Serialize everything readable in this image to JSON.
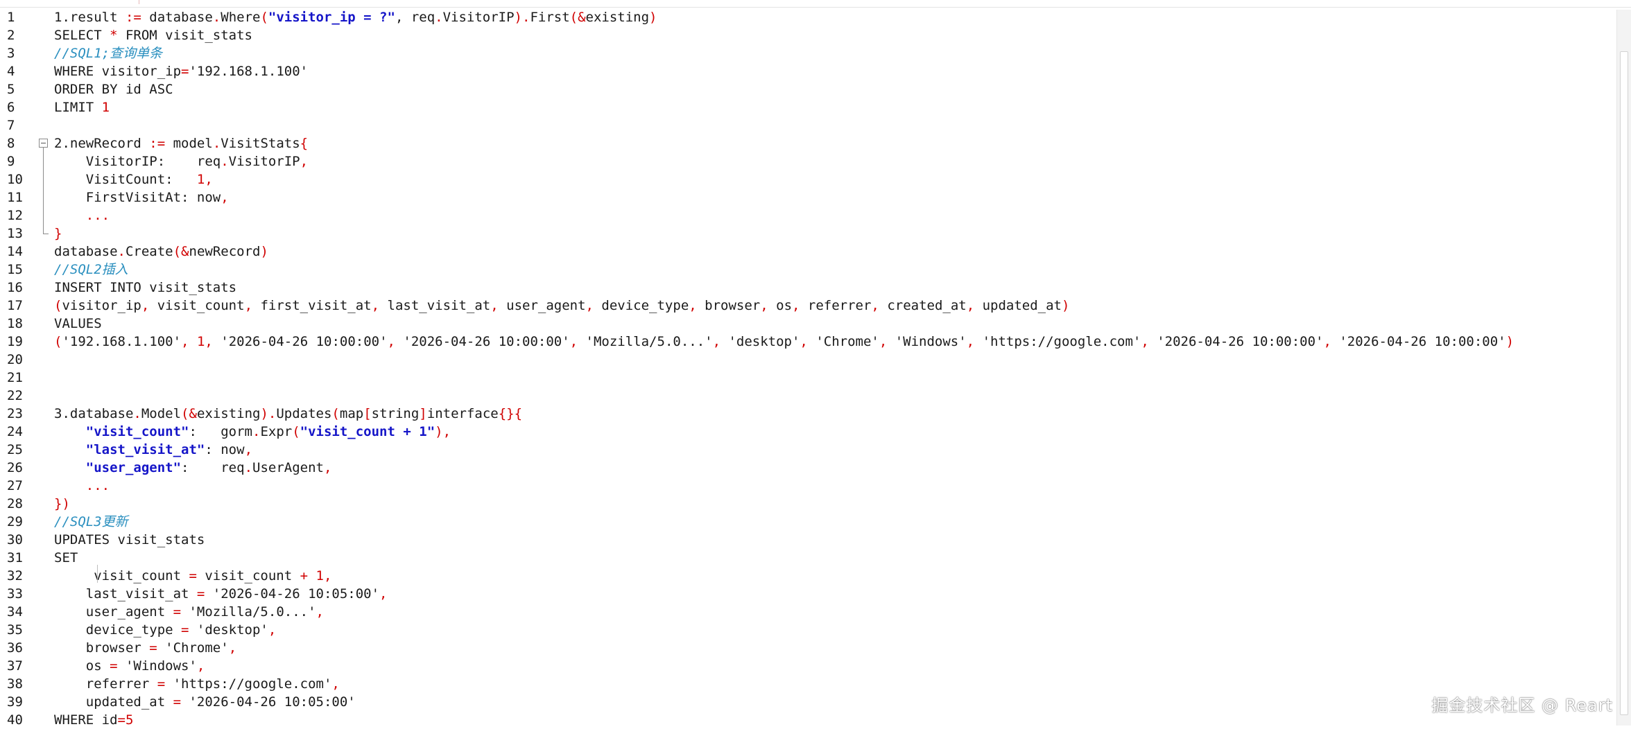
{
  "editor": {
    "line_numbers": [
      "1",
      "2",
      "3",
      "4",
      "5",
      "6",
      "7",
      "8",
      "9",
      "10",
      "11",
      "12",
      "13",
      "14",
      "15",
      "16",
      "17",
      "18",
      "19",
      "20",
      "21",
      "22",
      "23",
      "24",
      "25",
      "26",
      "27",
      "28",
      "29",
      "30",
      "31",
      "32",
      "33",
      "34",
      "35",
      "36",
      "37",
      "38",
      "39",
      "40"
    ],
    "lines": [
      [
        {
          "t": "1.result ",
          "c": "txt"
        },
        {
          "t": ":=",
          "c": "op"
        },
        {
          "t": " database",
          "c": "txt"
        },
        {
          "t": ".",
          "c": "op"
        },
        {
          "t": "Where",
          "c": "txt"
        },
        {
          "t": "(",
          "c": "op"
        },
        {
          "t": "\"visitor_ip = ?\"",
          "c": "str"
        },
        {
          "t": ", req",
          "c": "txt"
        },
        {
          "t": ".",
          "c": "op"
        },
        {
          "t": "VisitorIP",
          "c": "txt"
        },
        {
          "t": ").",
          "c": "op"
        },
        {
          "t": "First",
          "c": "txt"
        },
        {
          "t": "(&",
          "c": "op"
        },
        {
          "t": "existing",
          "c": "txt"
        },
        {
          "t": ")",
          "c": "op"
        }
      ],
      [
        {
          "t": "SELECT ",
          "c": "txt"
        },
        {
          "t": "*",
          "c": "op"
        },
        {
          "t": " FROM visit_stats",
          "c": "txt"
        }
      ],
      [
        {
          "t": "//SQL1;查询单条",
          "c": "cm"
        }
      ],
      [
        {
          "t": "WHERE visitor_ip",
          "c": "txt"
        },
        {
          "t": "=",
          "c": "op"
        },
        {
          "t": "'192.168.1.100'",
          "c": "txt"
        }
      ],
      [
        {
          "t": "ORDER BY id ASC",
          "c": "txt"
        }
      ],
      [
        {
          "t": "LIMIT ",
          "c": "txt"
        },
        {
          "t": "1",
          "c": "num"
        }
      ],
      [],
      [
        {
          "t": "2.newRecord ",
          "c": "txt"
        },
        {
          "t": ":=",
          "c": "op"
        },
        {
          "t": " model",
          "c": "txt"
        },
        {
          "t": ".",
          "c": "op"
        },
        {
          "t": "VisitStats",
          "c": "txt"
        },
        {
          "t": "{",
          "c": "op"
        }
      ],
      [
        {
          "t": "    VisitorIP:    req",
          "c": "txt"
        },
        {
          "t": ".",
          "c": "op"
        },
        {
          "t": "VisitorIP",
          "c": "txt"
        },
        {
          "t": ",",
          "c": "op"
        }
      ],
      [
        {
          "t": "    VisitCount:   ",
          "c": "txt"
        },
        {
          "t": "1",
          "c": "num"
        },
        {
          "t": ",",
          "c": "op"
        }
      ],
      [
        {
          "t": "    FirstVisitAt: now",
          "c": "txt"
        },
        {
          "t": ",",
          "c": "op"
        }
      ],
      [
        {
          "t": "    ",
          "c": "txt"
        },
        {
          "t": "...",
          "c": "op"
        }
      ],
      [
        {
          "t": "}",
          "c": "op"
        }
      ],
      [
        {
          "t": "database",
          "c": "txt"
        },
        {
          "t": ".",
          "c": "op"
        },
        {
          "t": "Create",
          "c": "txt"
        },
        {
          "t": "(&",
          "c": "op"
        },
        {
          "t": "newRecord",
          "c": "txt"
        },
        {
          "t": ")",
          "c": "op"
        }
      ],
      [
        {
          "t": "//SQL2插入",
          "c": "cm"
        }
      ],
      [
        {
          "t": "INSERT INTO visit_stats",
          "c": "txt"
        }
      ],
      [
        {
          "t": "(",
          "c": "op"
        },
        {
          "t": "visitor_ip",
          "c": "txt"
        },
        {
          "t": ",",
          "c": "op"
        },
        {
          "t": " visit_count",
          "c": "txt"
        },
        {
          "t": ",",
          "c": "op"
        },
        {
          "t": " first_visit_at",
          "c": "txt"
        },
        {
          "t": ",",
          "c": "op"
        },
        {
          "t": " last_visit_at",
          "c": "txt"
        },
        {
          "t": ",",
          "c": "op"
        },
        {
          "t": " user_agent",
          "c": "txt"
        },
        {
          "t": ",",
          "c": "op"
        },
        {
          "t": " device_type",
          "c": "txt"
        },
        {
          "t": ",",
          "c": "op"
        },
        {
          "t": " browser",
          "c": "txt"
        },
        {
          "t": ",",
          "c": "op"
        },
        {
          "t": " os",
          "c": "txt"
        },
        {
          "t": ",",
          "c": "op"
        },
        {
          "t": " referrer",
          "c": "txt"
        },
        {
          "t": ",",
          "c": "op"
        },
        {
          "t": " created_at",
          "c": "txt"
        },
        {
          "t": ",",
          "c": "op"
        },
        {
          "t": " updated_at",
          "c": "txt"
        },
        {
          "t": ")",
          "c": "op"
        }
      ],
      [
        {
          "t": "VALUES",
          "c": "txt"
        }
      ],
      [
        {
          "t": "(",
          "c": "op"
        },
        {
          "t": "'192.168.1.100'",
          "c": "txt"
        },
        {
          "t": ",",
          "c": "op"
        },
        {
          "t": " ",
          "c": "txt"
        },
        {
          "t": "1",
          "c": "num"
        },
        {
          "t": ",",
          "c": "op"
        },
        {
          "t": " '2026-04-26 10:00:00'",
          "c": "txt"
        },
        {
          "t": ",",
          "c": "op"
        },
        {
          "t": " '2026-04-26 10:00:00'",
          "c": "txt"
        },
        {
          "t": ",",
          "c": "op"
        },
        {
          "t": " 'Mozilla/5.0...'",
          "c": "txt"
        },
        {
          "t": ",",
          "c": "op"
        },
        {
          "t": " 'desktop'",
          "c": "txt"
        },
        {
          "t": ",",
          "c": "op"
        },
        {
          "t": " 'Chrome'",
          "c": "txt"
        },
        {
          "t": ",",
          "c": "op"
        },
        {
          "t": " 'Windows'",
          "c": "txt"
        },
        {
          "t": ",",
          "c": "op"
        },
        {
          "t": " 'https://google.com'",
          "c": "txt"
        },
        {
          "t": ",",
          "c": "op"
        },
        {
          "t": " '2026-04-26 10:00:00'",
          "c": "txt"
        },
        {
          "t": ",",
          "c": "op"
        },
        {
          "t": " '2026-04-26 10:00:00'",
          "c": "txt"
        },
        {
          "t": ")",
          "c": "op"
        }
      ],
      [],
      [],
      [],
      [
        {
          "t": "3.database",
          "c": "txt"
        },
        {
          "t": ".",
          "c": "op"
        },
        {
          "t": "Model",
          "c": "txt"
        },
        {
          "t": "(&",
          "c": "op"
        },
        {
          "t": "existing",
          "c": "txt"
        },
        {
          "t": ").",
          "c": "op"
        },
        {
          "t": "Updates",
          "c": "txt"
        },
        {
          "t": "(",
          "c": "op"
        },
        {
          "t": "map",
          "c": "txt"
        },
        {
          "t": "[",
          "c": "op"
        },
        {
          "t": "string",
          "c": "txt"
        },
        {
          "t": "]",
          "c": "op"
        },
        {
          "t": "interface",
          "c": "txt"
        },
        {
          "t": "{}{",
          "c": "op"
        }
      ],
      [
        {
          "t": "    ",
          "c": "txt"
        },
        {
          "t": "\"visit_count\"",
          "c": "str"
        },
        {
          "t": ":   gorm",
          "c": "txt"
        },
        {
          "t": ".",
          "c": "op"
        },
        {
          "t": "Expr",
          "c": "txt"
        },
        {
          "t": "(",
          "c": "op"
        },
        {
          "t": "\"visit_count + 1\"",
          "c": "str"
        },
        {
          "t": "),",
          "c": "op"
        }
      ],
      [
        {
          "t": "    ",
          "c": "txt"
        },
        {
          "t": "\"last_visit_at\"",
          "c": "str"
        },
        {
          "t": ": now",
          "c": "txt"
        },
        {
          "t": ",",
          "c": "op"
        }
      ],
      [
        {
          "t": "    ",
          "c": "txt"
        },
        {
          "t": "\"user_agent\"",
          "c": "str"
        },
        {
          "t": ":    req",
          "c": "txt"
        },
        {
          "t": ".",
          "c": "op"
        },
        {
          "t": "UserAgent",
          "c": "txt"
        },
        {
          "t": ",",
          "c": "op"
        }
      ],
      [
        {
          "t": "    ",
          "c": "txt"
        },
        {
          "t": "...",
          "c": "op"
        }
      ],
      [
        {
          "t": "})",
          "c": "op"
        }
      ],
      [
        {
          "t": "//SQL3更新",
          "c": "cm"
        }
      ],
      [
        {
          "t": "UPDATES visit_stats",
          "c": "txt"
        }
      ],
      [
        {
          "t": "SET",
          "c": "txt"
        }
      ],
      [
        {
          "t": "     visit_count ",
          "c": "txt"
        },
        {
          "t": "=",
          "c": "op"
        },
        {
          "t": " visit_count ",
          "c": "txt"
        },
        {
          "t": "+",
          "c": "op"
        },
        {
          "t": " ",
          "c": "txt"
        },
        {
          "t": "1",
          "c": "num"
        },
        {
          "t": ",",
          "c": "op"
        }
      ],
      [
        {
          "t": "    last_visit_at ",
          "c": "txt"
        },
        {
          "t": "=",
          "c": "op"
        },
        {
          "t": " '2026-04-26 10:05:00'",
          "c": "txt"
        },
        {
          "t": ",",
          "c": "op"
        }
      ],
      [
        {
          "t": "    user_agent ",
          "c": "txt"
        },
        {
          "t": "=",
          "c": "op"
        },
        {
          "t": " 'Mozilla/5.0...'",
          "c": "txt"
        },
        {
          "t": ",",
          "c": "op"
        }
      ],
      [
        {
          "t": "    device_type ",
          "c": "txt"
        },
        {
          "t": "=",
          "c": "op"
        },
        {
          "t": " 'desktop'",
          "c": "txt"
        },
        {
          "t": ",",
          "c": "op"
        }
      ],
      [
        {
          "t": "    browser ",
          "c": "txt"
        },
        {
          "t": "=",
          "c": "op"
        },
        {
          "t": " 'Chrome'",
          "c": "txt"
        },
        {
          "t": ",",
          "c": "op"
        }
      ],
      [
        {
          "t": "    os ",
          "c": "txt"
        },
        {
          "t": "=",
          "c": "op"
        },
        {
          "t": " 'Windows'",
          "c": "txt"
        },
        {
          "t": ",",
          "c": "op"
        }
      ],
      [
        {
          "t": "    referrer ",
          "c": "txt"
        },
        {
          "t": "=",
          "c": "op"
        },
        {
          "t": " 'https://google.com'",
          "c": "txt"
        },
        {
          "t": ",",
          "c": "op"
        }
      ],
      [
        {
          "t": "    updated_at ",
          "c": "txt"
        },
        {
          "t": "=",
          "c": "op"
        },
        {
          "t": " '2026-04-26 10:05:00'",
          "c": "txt"
        }
      ],
      [
        {
          "t": "WHERE id",
          "c": "txt"
        },
        {
          "t": "=",
          "c": "op"
        },
        {
          "t": "5",
          "c": "num"
        }
      ]
    ]
  },
  "colors": {
    "text": "#1a1a1a",
    "operator": "#d00000",
    "string": "#1515c8",
    "comment": "#2a8fbf",
    "number": "#d00000"
  },
  "watermark": {
    "text": "掘金技术社区 @ Reart"
  }
}
